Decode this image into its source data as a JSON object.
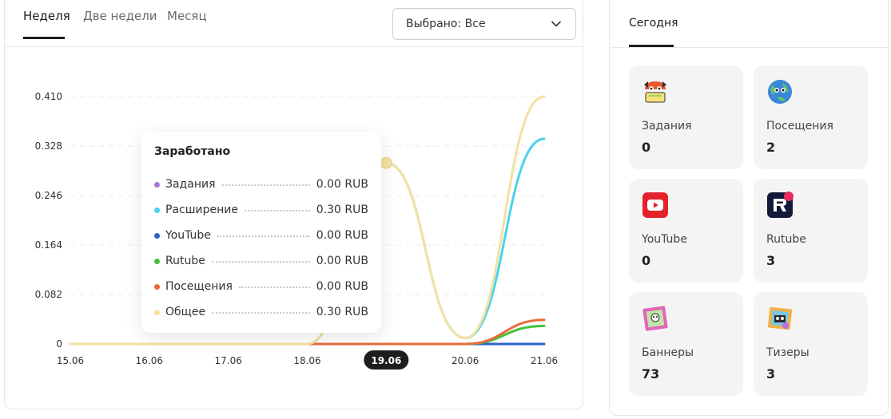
{
  "tabs": [
    {
      "label": "Неделя",
      "active": true
    },
    {
      "label": "Две недели",
      "active": false
    },
    {
      "label": "Месяц",
      "active": false
    }
  ],
  "select": {
    "value": "Выбрано: Все"
  },
  "tooltip": {
    "title": "Заработано",
    "rows": [
      {
        "label": "Задания",
        "value": "0.00 RUB",
        "color": "#a575dd"
      },
      {
        "label": "Расширение",
        "value": "0.30 RUB",
        "color": "#49d3ee"
      },
      {
        "label": "YouTube",
        "value": "0.00 RUB",
        "color": "#2d5fc4"
      },
      {
        "label": "Rutube",
        "value": "0.00 RUB",
        "color": "#3fc23b"
      },
      {
        "label": "Посещения",
        "value": "0.00 RUB",
        "color": "#ea6a3a"
      },
      {
        "label": "Общее",
        "value": "0.30 RUB",
        "color": "#f4e1a0"
      }
    ]
  },
  "chart_data": {
    "type": "line",
    "x": [
      "15.06",
      "16.06",
      "17.06",
      "18.06",
      "19.06",
      "20.06",
      "21.06"
    ],
    "highlighted_x": "19.06",
    "y_ticks": [
      "0",
      "0.082",
      "0.164",
      "0.246",
      "0.328",
      "0.410"
    ],
    "ylim": [
      0,
      0.41
    ],
    "grid": true,
    "series": [
      {
        "name": "Задания",
        "color": "#a575dd",
        "values": [
          0,
          0,
          0,
          0,
          0,
          0,
          0
        ]
      },
      {
        "name": "Расширение",
        "color": "#49d3ee",
        "values": [
          0,
          0,
          0,
          0,
          0.3,
          0.01,
          0.34
        ]
      },
      {
        "name": "YouTube",
        "color": "#2d5fc4",
        "values": [
          0,
          0,
          0,
          0,
          0,
          0,
          0
        ]
      },
      {
        "name": "Rutube",
        "color": "#3fc23b",
        "values": [
          0,
          0,
          0,
          0,
          0,
          0,
          0.03
        ]
      },
      {
        "name": "Посещения",
        "color": "#ea6a3a",
        "values": [
          0,
          0,
          0,
          0,
          0,
          0,
          0.04
        ]
      },
      {
        "name": "Общее",
        "color": "#f4e1a0",
        "values": [
          0,
          0,
          0,
          0,
          0.3,
          0.01,
          0.41
        ]
      }
    ]
  },
  "today": {
    "tab_label": "Сегодня",
    "cards": [
      {
        "label": "Задания",
        "value": "0",
        "icon": "tasks-icon"
      },
      {
        "label": "Посещения",
        "value": "2",
        "icon": "visits-icon"
      },
      {
        "label": "YouTube",
        "value": "0",
        "icon": "youtube-icon"
      },
      {
        "label": "Rutube",
        "value": "3",
        "icon": "rutube-icon"
      },
      {
        "label": "Баннеры",
        "value": "73",
        "icon": "banners-icon"
      },
      {
        "label": "Тизеры",
        "value": "3",
        "icon": "teasers-icon"
      }
    ]
  }
}
